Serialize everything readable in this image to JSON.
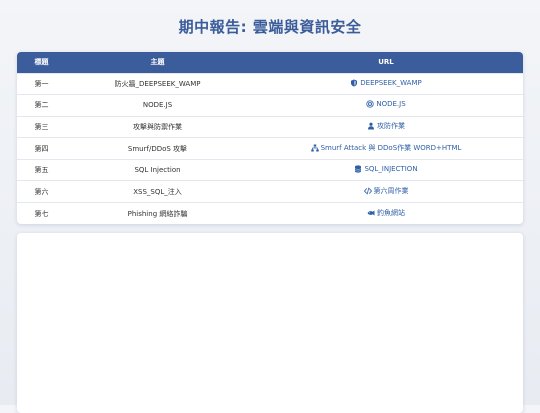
{
  "page": {
    "title": "期中報告: 雲端與資訊安全"
  },
  "colors": {
    "accent": "#3c5d9c",
    "title": "#3b5c9a",
    "link": "#2f5fa6",
    "background": "#eef1f5"
  },
  "table": {
    "headers": [
      "標題",
      "主題",
      "URL"
    ],
    "rows": [
      {
        "label": "第一",
        "topic": "防火牆_DEEPSEEK_WAMP",
        "icon": "shield-icon",
        "link": "DEEPSEEK_WAMP"
      },
      {
        "label": "第二",
        "topic": "NODE.JS",
        "icon": "target-icon",
        "link": "NODE.JS"
      },
      {
        "label": "第三",
        "topic": "攻擊與防禦作業",
        "icon": "user-icon",
        "link": "攻防作業"
      },
      {
        "label": "第四",
        "topic": "Smurf/DDoS 攻擊",
        "icon": "network-icon",
        "link": "Smurf Attack 與 DDoS作業 WORD+HTML"
      },
      {
        "label": "第五",
        "topic": "SQL Injection",
        "icon": "database-icon",
        "link": "SQL_INJECTION"
      },
      {
        "label": "第六",
        "topic": "XSS_SQL_注入",
        "icon": "code-icon",
        "link": "第六周作業"
      },
      {
        "label": "第七",
        "topic": "Phishing 網絡詐騙",
        "icon": "fish-icon",
        "link": "釣魚網站"
      }
    ]
  }
}
